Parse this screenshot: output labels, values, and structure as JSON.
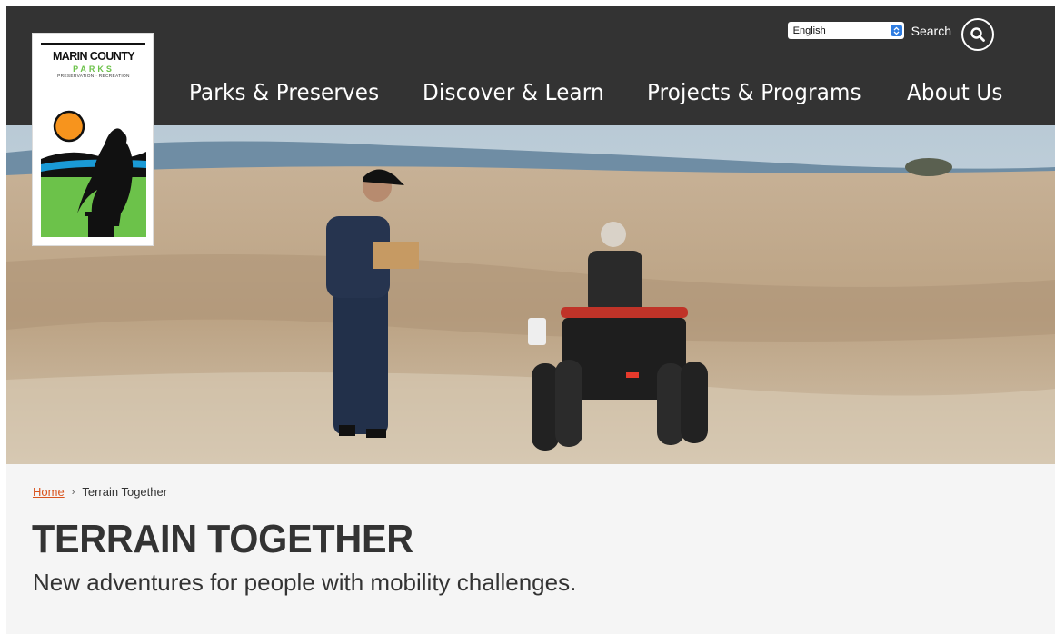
{
  "colors": {
    "header_bg": "#333333",
    "link": "#d9541e",
    "content_bg": "#f5f5f5",
    "text": "#333333",
    "logo_green": "#6cc24a",
    "logo_orange": "#f7941d",
    "logo_blue": "#1a9ad6"
  },
  "logo": {
    "name": "MARIN COUNTY",
    "parks": "PARKS",
    "tagline": "PRESERVATION · RECREATION"
  },
  "utility": {
    "language": "English",
    "search_label": "Search"
  },
  "nav": {
    "items": [
      {
        "label": "Parks & Preserves"
      },
      {
        "label": "Discover & Learn"
      },
      {
        "label": "Projects & Programs"
      },
      {
        "label": "About Us"
      }
    ]
  },
  "hero": {
    "image": "photo of ranger with box and person in all-terrain wheelchair on grassy headland"
  },
  "breadcrumb": {
    "home": "Home",
    "separator": "›",
    "current": "Terrain Together"
  },
  "page": {
    "title": "TERRAIN TOGETHER",
    "subtitle": "New adventures for people with mobility challenges."
  },
  "icons": {
    "search": "search-icon",
    "select_arrows": "chevron-updown-icon"
  }
}
